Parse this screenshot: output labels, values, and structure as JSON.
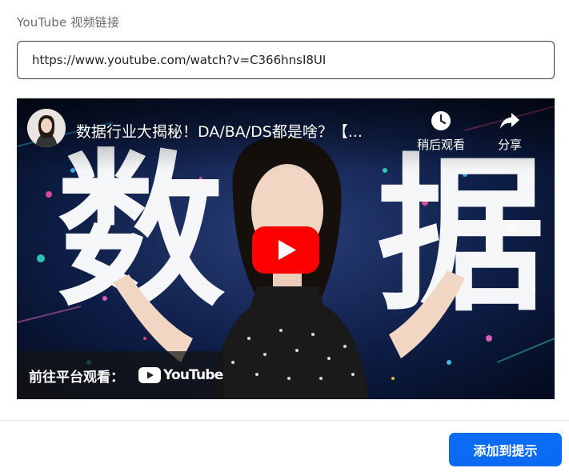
{
  "form": {
    "label": "YouTube 视频链接",
    "url_value": "https://www.youtube.com/watch?v=C366hnsI8UI"
  },
  "video": {
    "title": "数据行业大揭秘！DA/BA/DS都是啥？【...",
    "thumbnail_text_left": "数",
    "thumbnail_text_right": "据",
    "watch_later_label": "稍后观看",
    "share_label": "分享",
    "watch_on_label": "前往平台观看：",
    "platform_name": "YouTube",
    "icons": [
      "clock-icon",
      "share-arrow-icon",
      "play-icon",
      "youtube-logo-icon"
    ]
  },
  "footer": {
    "add_button_label": "添加到提示"
  },
  "colors": {
    "accent": "#0a6cf5",
    "youtube_red": "#ff0000"
  }
}
